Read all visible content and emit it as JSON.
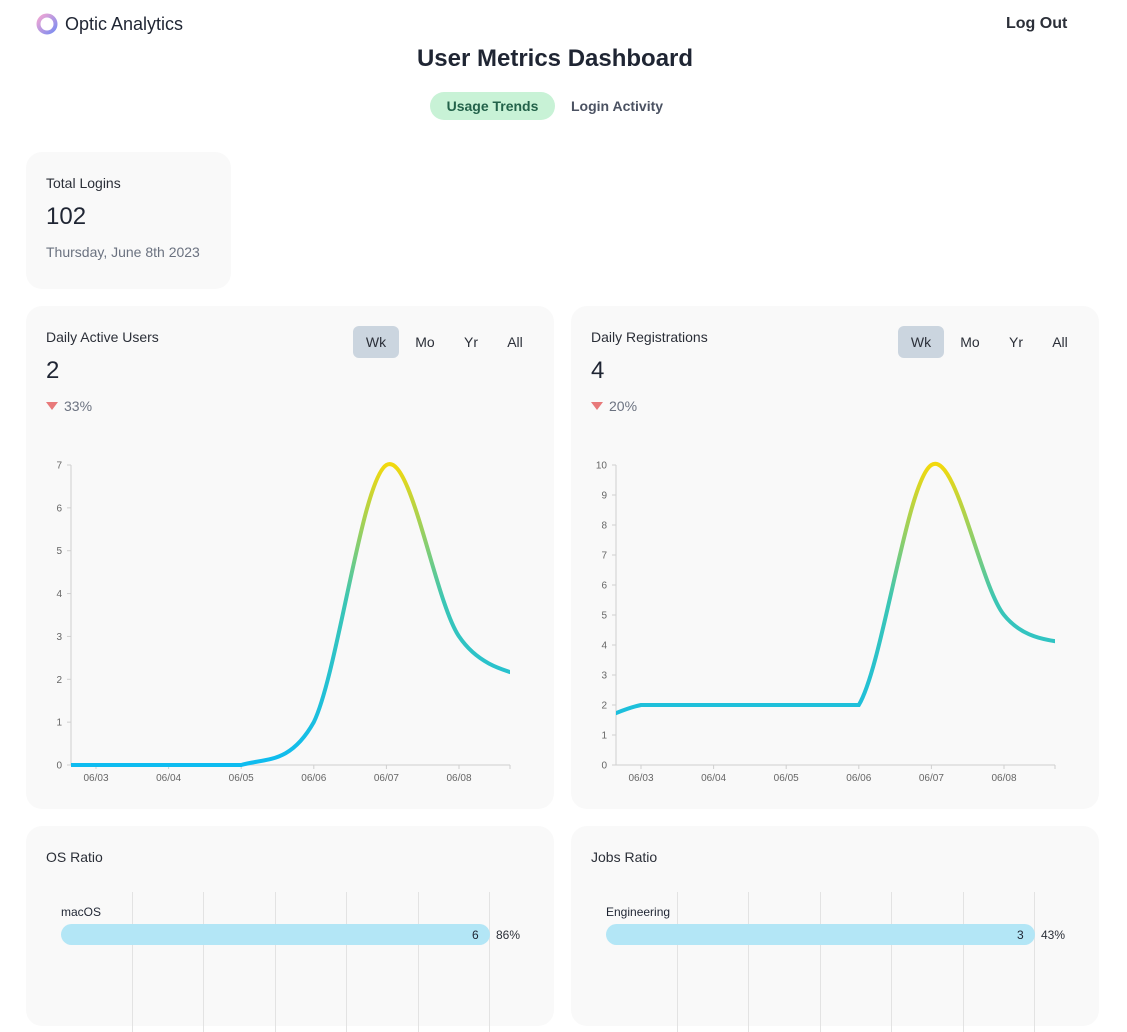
{
  "header": {
    "brand": "Optic Analytics",
    "logout_label": "Log Out"
  },
  "page": {
    "title": "User Metrics Dashboard",
    "tabs": [
      {
        "label": "Usage Trends",
        "active": true
      },
      {
        "label": "Login Activity",
        "active": false
      }
    ]
  },
  "total_logins": {
    "label": "Total Logins",
    "value": "102",
    "date": "Thursday, June 8th 2023"
  },
  "period_options": [
    "Wk",
    "Mo",
    "Yr",
    "All"
  ],
  "colors": {
    "line_low": "#0ebcf0",
    "line_mid": "#3cc6b4",
    "line_high": "#f2d90e",
    "delta_down": "#e8797a",
    "bar_fill": "#b3e6f6",
    "tab_active_bg": "#c8f2d6",
    "period_selected_bg": "#cbd5df"
  },
  "dau": {
    "label": "Daily Active Users",
    "value": "2",
    "delta": "33%",
    "delta_direction": "down",
    "selected_period": "Wk"
  },
  "registrations": {
    "label": "Daily Registrations",
    "value": "4",
    "delta": "20%",
    "delta_direction": "down",
    "selected_period": "Wk"
  },
  "chart_data": [
    {
      "type": "line",
      "x": [
        "06/03",
        "06/04",
        "06/05",
        "06/06",
        "06/07",
        "06/08"
      ],
      "series": [
        {
          "x": [
            "06/02",
            "06/03",
            "06/04",
            "06/05",
            "06/06",
            "06/07",
            "06/08",
            "06/09"
          ],
          "values": [
            0,
            0,
            0,
            0,
            1,
            7,
            3,
            2
          ]
        }
      ],
      "xlabel": "",
      "ylabel": "",
      "yticks": [
        "0",
        "1",
        "2",
        "3",
        "4",
        "5",
        "6",
        "7"
      ],
      "ylim": [
        0,
        7
      ],
      "grid": false
    },
    {
      "type": "line",
      "x": [
        "06/03",
        "06/04",
        "06/05",
        "06/06",
        "06/07",
        "06/08"
      ],
      "series": [
        {
          "x": [
            "06/02",
            "06/03",
            "06/04",
            "06/05",
            "06/06",
            "06/07",
            "06/08",
            "06/09"
          ],
          "values": [
            1,
            2,
            2,
            2,
            2,
            10,
            5,
            4
          ]
        }
      ],
      "xlabel": "",
      "ylabel": "",
      "yticks": [
        "0",
        "1",
        "2",
        "3",
        "4",
        "5",
        "6",
        "7",
        "8",
        "9",
        "10"
      ],
      "ylim": [
        0,
        10
      ],
      "grid": false
    }
  ],
  "os_ratio": {
    "label": "OS Ratio",
    "bars": [
      {
        "name": "macOS",
        "count": "6",
        "percent": "86%",
        "fraction": 0.86
      }
    ]
  },
  "jobs_ratio": {
    "label": "Jobs Ratio",
    "bars": [
      {
        "name": "Engineering",
        "count": "3",
        "percent": "43%",
        "fraction": 0.43
      }
    ]
  }
}
